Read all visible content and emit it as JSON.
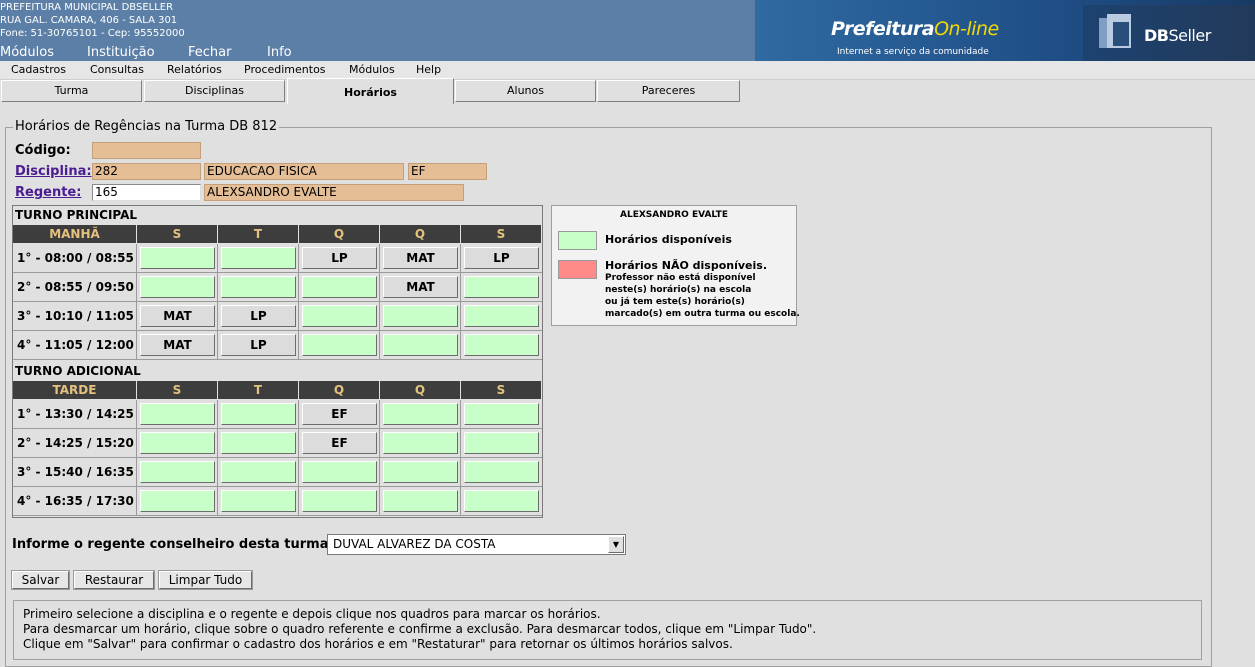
{
  "header": {
    "org_lines": [
      "PREFEITURA MUNICIPAL DBSELLER",
      "RUA GAL. CAMARA, 406 - SALA 301",
      "Fone: 51-30765101  -  Cep: 95552000"
    ],
    "top_menu": [
      "Módulos",
      "Instituição",
      "Fechar",
      "Info"
    ],
    "logo_prefeitura": "Prefeitura",
    "logo_online": "On-line",
    "logo_tagline": "Internet a serviço da comunidade",
    "logo_db": "DB",
    "logo_seller": "Seller"
  },
  "menubar": [
    "Cadastros",
    "Consultas",
    "Relatórios",
    "Procedimentos",
    "Módulos",
    "Help"
  ],
  "tabs": [
    "Turma",
    "Disciplinas",
    "Horários",
    "Alunos",
    "Pareceres"
  ],
  "active_tab": "Horários",
  "form": {
    "legend": "Horários de Regências na Turma DB 812",
    "codigo_label": "Código:",
    "codigo_value": "",
    "disciplina_label": "Disciplina:",
    "disciplina_code": "282",
    "disciplina_name": "EDUCACAO FISICA",
    "disciplina_abbr": "EF",
    "regente_label": "Regente:",
    "regente_code": "165",
    "regente_name": "ALEXSANDRO EVALTE"
  },
  "schedule": {
    "days": [
      "S",
      "T",
      "Q",
      "Q",
      "S"
    ],
    "principal": {
      "title": "TURNO PRINCIPAL",
      "period": "MANHÃ",
      "rows": [
        {
          "label": "1° - 08:00 / 08:55",
          "cells": [
            "",
            "",
            "LP",
            "MAT",
            "LP"
          ]
        },
        {
          "label": "2° - 08:55 / 09:50",
          "cells": [
            "",
            "",
            "",
            "MAT",
            ""
          ]
        },
        {
          "label": "3° - 10:10 / 11:05",
          "cells": [
            "MAT",
            "LP",
            "",
            "",
            ""
          ]
        },
        {
          "label": "4° - 11:05 / 12:00",
          "cells": [
            "MAT",
            "LP",
            "",
            "",
            ""
          ]
        }
      ]
    },
    "adicional": {
      "title": "TURNO ADICIONAL",
      "period": "TARDE",
      "rows": [
        {
          "label": "1° - 13:30 / 14:25",
          "cells": [
            "",
            "",
            "EF",
            "",
            ""
          ]
        },
        {
          "label": "2° - 14:25 / 15:20",
          "cells": [
            "",
            "",
            "EF",
            "",
            ""
          ]
        },
        {
          "label": "3° - 15:40 / 16:35",
          "cells": [
            "",
            "",
            "",
            "",
            ""
          ]
        },
        {
          "label": "4° - 16:35 / 17:30",
          "cells": [
            "",
            "",
            "",
            "",
            ""
          ]
        }
      ]
    },
    "available_color": "#c8ffc8",
    "assigned_color": "#dcdcdc"
  },
  "legend": {
    "title": "ALEXSANDRO EVALTE",
    "available": "Horários disponíveis",
    "unavailable": "Horários NÃO disponíveis.",
    "unavailable_notes": [
      "Professor não está disponível",
      "neste(s) horário(s) na escola",
      "ou já tem este(s) horário(s)",
      "marcado(s) em outra turma ou escola."
    ],
    "available_color": "#c8ffc8",
    "unavailable_color": "#ff8a8a"
  },
  "conselheiro": {
    "label": "Informe o regente conselheiro desta turma:",
    "selected": "DUVAL ALVAREZ DA COSTA"
  },
  "buttons": {
    "salvar": "Salvar",
    "restaurar": "Restaurar",
    "limpar": "Limpar Tudo"
  },
  "help": [
    "Primeiro selecione a disciplina e o regente e depois clique nos quadros para marcar os horários.",
    "Para desmarcar um horário, clique sobre o quadro referente e confirme a exclusão. Para desmarcar todos, clique em \"Limpar Tudo\".",
    "Clique em \"Salvar\" para confirmar o cadastro dos horários e em \"Restaturar\" para retornar os últimos horários salvos."
  ]
}
